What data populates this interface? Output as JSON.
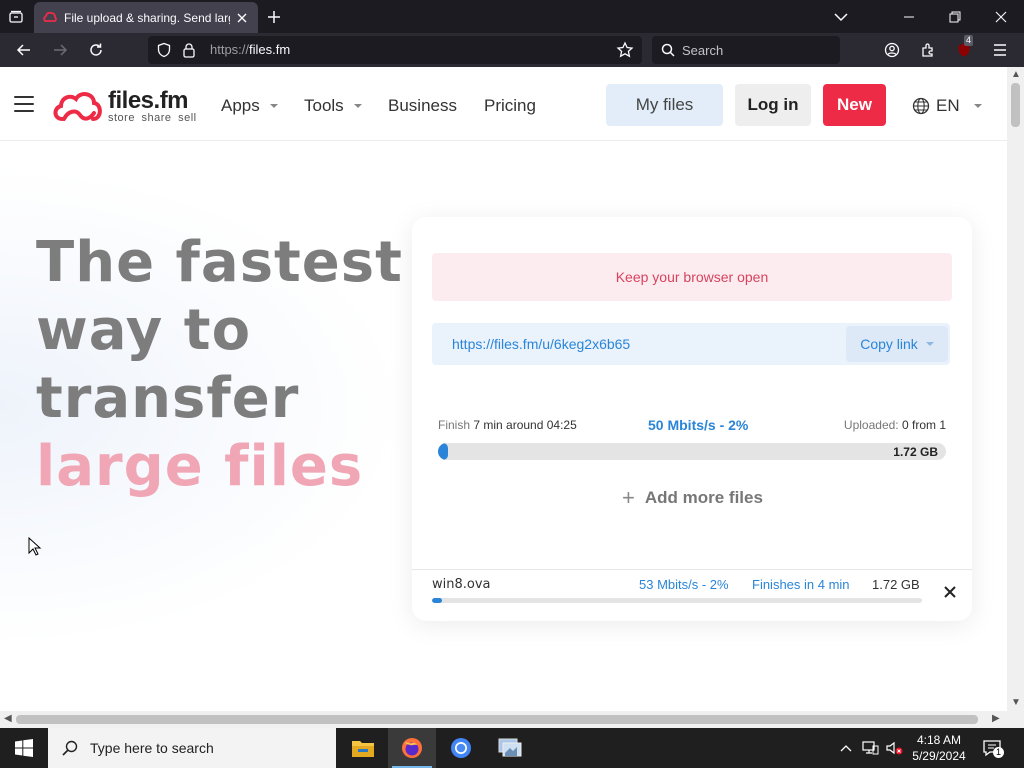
{
  "browser": {
    "tab_title": "File upload & sharing. Send larg",
    "url_protocol": "https://",
    "url_host": "files.fm",
    "search_placeholder": "Search",
    "extension_badge": "4"
  },
  "site": {
    "logo_name": "files.fm",
    "logo_tagline": "store share sell",
    "menu": {
      "apps": "Apps",
      "tools": "Tools",
      "business": "Business",
      "pricing": "Pricing"
    },
    "my_files_label": "My files",
    "login_label": "Log in",
    "new_label": "New",
    "language": "EN"
  },
  "hero": {
    "line1": "The fastest",
    "line2": "way to",
    "line3": "transfer",
    "line4": "large files"
  },
  "upload": {
    "alert": "Keep your browser open",
    "share_link": "https://files.fm/u/6keg2x6b65",
    "copy_link_label": "Copy link",
    "finish_label": "Finish",
    "finish_value": "7 min around 04:25",
    "speed": "50 Mbits/s - 2%",
    "uploaded_label": "Uploaded:",
    "uploaded_value": "0 from 1",
    "total_size": "1.72 GB",
    "progress": 0.02,
    "add_more_label": "Add more files",
    "file": {
      "name": "win8.ova",
      "speed": "53 Mbits/s - 2%",
      "eta": "Finishes in 4 min",
      "size": "1.72 GB",
      "progress": 0.02
    }
  },
  "taskbar": {
    "search_placeholder": "Type here to search",
    "time": "4:18 AM",
    "date": "5/29/2024",
    "notification_count": "1"
  },
  "colors": {
    "brand_red": "#ee2b47",
    "accent_blue": "#2a85d8",
    "hero_pink": "#f0a6b4"
  }
}
